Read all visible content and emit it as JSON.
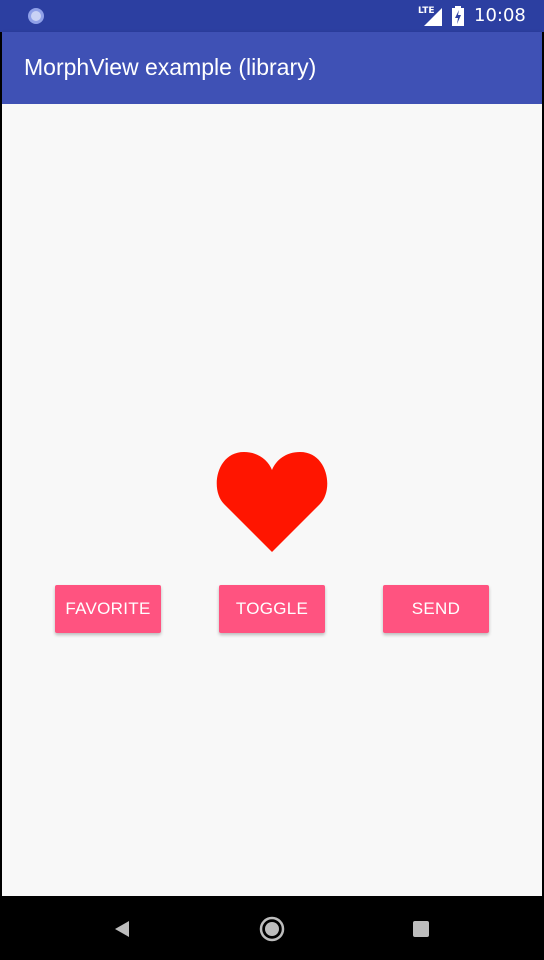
{
  "status_bar": {
    "network_label": "LTE",
    "time": "10:08",
    "icons": [
      "system-icon",
      "signal-icon",
      "battery-icon"
    ]
  },
  "app_bar": {
    "title": "MorphView example (library)",
    "color": "#3f51b5"
  },
  "main": {
    "morph_icon": "heart-icon",
    "morph_color": "#ff1500",
    "buttons": [
      {
        "label": "FAVORITE"
      },
      {
        "label": "TOGGLE"
      },
      {
        "label": "SEND"
      }
    ],
    "button_color": "#ff5380"
  },
  "nav_bar": {
    "icons": [
      "back-icon",
      "home-icon",
      "recents-icon"
    ]
  }
}
